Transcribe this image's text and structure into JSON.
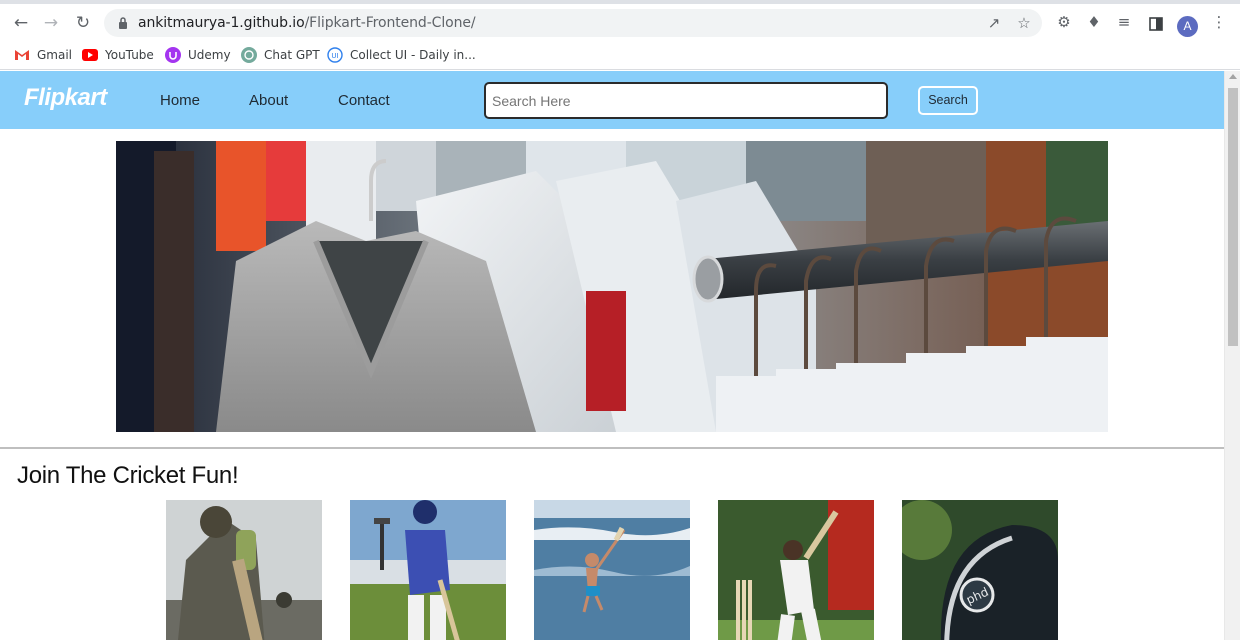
{
  "browser": {
    "url_host": "ankitmaurya-1.github.io",
    "url_path": "/Flipkart-Frontend-Clone/",
    "profile_initial": "A",
    "bookmarks": [
      {
        "label": "Gmail",
        "icon": "gmail-icon",
        "color": "#ea4335"
      },
      {
        "label": "YouTube",
        "icon": "youtube-icon",
        "color": "#ff0000"
      },
      {
        "label": "Udemy",
        "icon": "udemy-icon",
        "color": "#a435f0"
      },
      {
        "label": "Chat GPT",
        "icon": "chatgpt-icon",
        "color": "#74aa9c"
      },
      {
        "label": "Collect UI - Daily in...",
        "icon": "collectui-icon",
        "color": "#2f80ed"
      }
    ]
  },
  "navbar": {
    "brand": "Flipkart",
    "links": [
      "Home",
      "About",
      "Contact"
    ],
    "search_placeholder": "Search Here",
    "search_button": "Search",
    "background": "#87cefa"
  },
  "hero": {
    "image": "clothes-rack-banner"
  },
  "section": {
    "title": "Join The Cricket Fun!",
    "cards": [
      {
        "image": "batsman-closeup"
      },
      {
        "image": "batsman-stadium"
      },
      {
        "image": "beach-cricket"
      },
      {
        "image": "batsman-shot"
      },
      {
        "image": "cricket-helmet"
      }
    ]
  }
}
